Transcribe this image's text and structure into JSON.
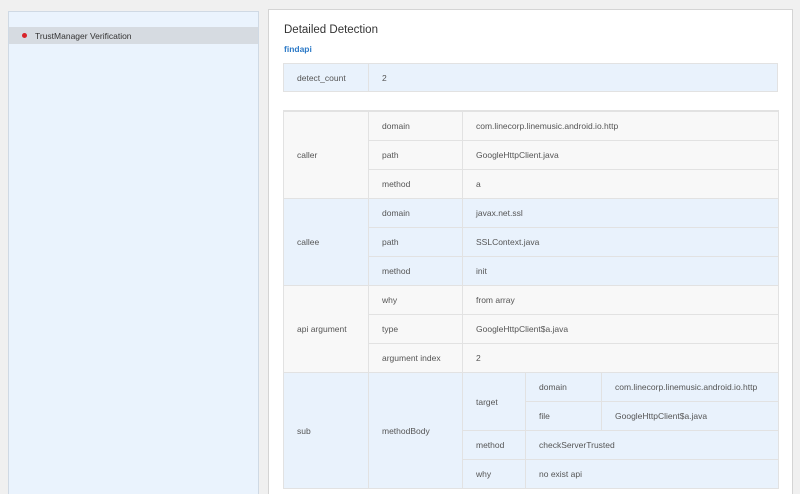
{
  "sidebar": {
    "items": [
      {
        "label": "TrustManager Verification"
      }
    ]
  },
  "main": {
    "title": "Detailed Detection",
    "api_link": "findapi",
    "detect_count": {
      "key": "detect_count",
      "value": "2"
    },
    "caller": {
      "label": "caller",
      "rows": [
        {
          "key": "domain",
          "value": "com.linecorp.linemusic.android.io.http"
        },
        {
          "key": "path",
          "value": "GoogleHttpClient.java"
        },
        {
          "key": "method",
          "value": "a"
        }
      ]
    },
    "callee": {
      "label": "callee",
      "rows": [
        {
          "key": "domain",
          "value": "javax.net.ssl"
        },
        {
          "key": "path",
          "value": "SSLContext.java"
        },
        {
          "key": "method",
          "value": "init"
        }
      ]
    },
    "api_argument": {
      "label": "api argument",
      "rows": [
        {
          "key": "why",
          "value": "from array"
        },
        {
          "key": "type",
          "value": "GoogleHttpClient$a.java"
        },
        {
          "key": "argument index",
          "value": "2"
        }
      ]
    },
    "sub": {
      "label": "sub",
      "method_body_label": "methodBody",
      "target_label": "target",
      "target_rows": [
        {
          "key": "domain",
          "value": "com.linecorp.linemusic.android.io.http"
        },
        {
          "key": "file",
          "value": "GoogleHttpClient$a.java"
        }
      ],
      "rows": [
        {
          "key": "method",
          "value": "checkServerTrusted"
        },
        {
          "key": "why",
          "value": "no exist api"
        }
      ]
    }
  }
}
